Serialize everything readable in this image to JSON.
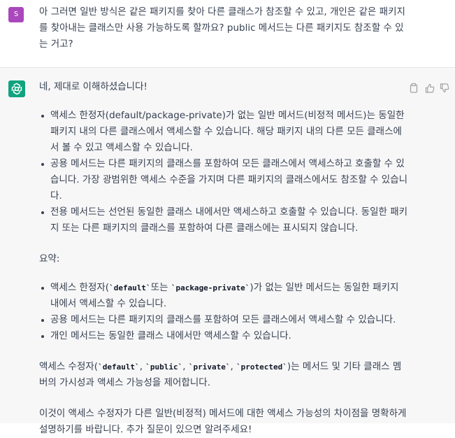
{
  "user": {
    "avatar_letter": "S",
    "message": "아 그러면 일반 방식은 같은 패키지를 찾아 다른 클래스가 참조할 수 있고, 개인은 같은 패키지를 찾아내는 클래스만 사용 가능하도록 할까요? public 메서드는 다른 패키지도 참조할 수 있는 거고?"
  },
  "assistant": {
    "avatar_icon": "openai-logo-icon",
    "intro": "네, 제대로 이해하셨습니다!",
    "list1": [
      "액세스 한정자(default/package-private)가 없는 일반 메서드(비정적 메서드)는 동일한 패키지 내의 다른 클래스에서 액세스할 수 있습니다. 해당 패키지 내의 다른 모든 클래스에서 볼 수 있고 액세스할 수 있습니다.",
      "공용 메서드는 다른 패키지의 클래스를 포함하여 모든 클래스에서 액세스하고 호출할 수 있습니다. 가장 광범위한 액세스 수준을 가지며 다른 패키지의 클래스에서도 참조할 수 있습니다.",
      "전용 메서드는 선언된 동일한 클래스 내에서만 액세스하고 호출할 수 있습니다. 동일한 패키지 또는 다른 패키지의 클래스를 포함하여 다른 클래스에는 표시되지 않습니다."
    ],
    "summary_label": "요약:",
    "list2_item1": {
      "prefix": "액세스 한정자(",
      "code1": "`default`",
      "mid": "또는 ",
      "code2": "`package-private`",
      "suffix": ")가 없는 일반 메서드는 동일한 패키지 내에서 액세스할 수 있습니다."
    },
    "list2_rest": [
      "공용 메서드는 다른 패키지의 클래스를 포함하여 모든 클래스에서 액세스할 수 있습니다.",
      "개인 메서드는 동일한 클래스 내에서만 액세스할 수 있습니다."
    ],
    "para3": {
      "prefix": "액세스 수정자(",
      "c1": "`default`",
      "c2": "`public`",
      "c3": "`private`",
      "c4": "`protected`",
      "sep": ", ",
      "suffix": ")는 메서드 및 기타 클래스 멤버의 가시성과 액세스 가능성을 제어합니다."
    },
    "closing": "이것이 액세스 수정자가 다른 일반(비정적) 메서드에 대한 액세스 가능성의 차이점을 명확하게 설명하기를 바랍니다. 추가 질문이 있으면 알려주세요!"
  },
  "actions": [
    {
      "icon": "copy-icon"
    },
    {
      "icon": "thumbs-up-icon"
    },
    {
      "icon": "thumbs-down-icon"
    }
  ],
  "colors": {
    "user_avatar": "#ab47bc",
    "assistant_avatar": "#10a37f",
    "assistant_bg": "#f7f7f8",
    "text": "#374151"
  }
}
